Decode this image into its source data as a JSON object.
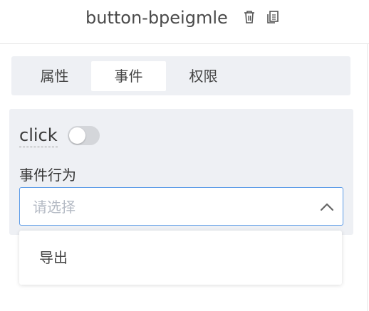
{
  "header": {
    "title": "button-bpeigmle",
    "delete_icon": "trash-icon",
    "copy_icon": "copy-icon"
  },
  "tabs": [
    {
      "label": "属性",
      "active": false
    },
    {
      "label": "事件",
      "active": true
    },
    {
      "label": "权限",
      "active": false
    }
  ],
  "event": {
    "name": "click",
    "enabled": false,
    "action_label": "事件行为",
    "select_placeholder": "请选择",
    "options": [
      "导出"
    ]
  },
  "colors": {
    "accent": "#5b9be8",
    "panel_bg": "#eef0f4",
    "toggle_off": "#d4d6da"
  }
}
